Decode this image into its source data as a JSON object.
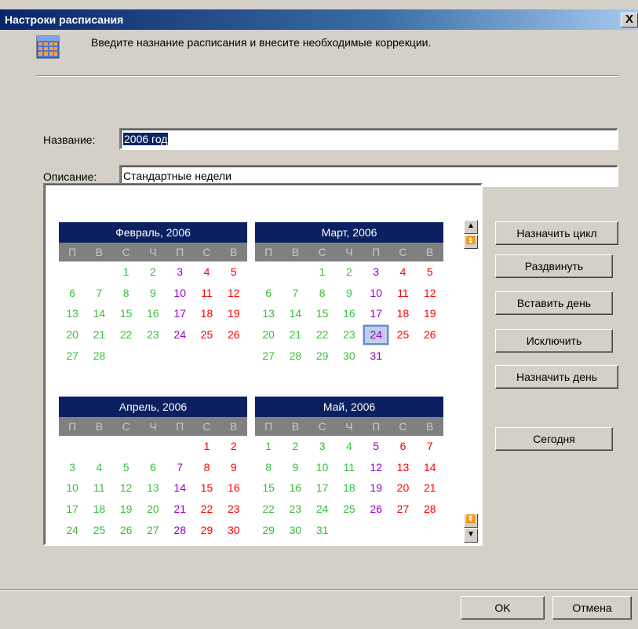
{
  "window": {
    "title": "Настроки расписания",
    "close_glyph": "X"
  },
  "header": {
    "message": "Введите назнание расписания и внесите необходимые коррекции.",
    "icon": "calendar-icon"
  },
  "form": {
    "name_label": "Название:",
    "name_value": "2006 год",
    "description_label": "Описание:",
    "description_value": "Стандартные недели"
  },
  "calendar": {
    "weekday_headers": [
      "П",
      "В",
      "С",
      "Ч",
      "П",
      "С",
      "В"
    ],
    "today": {
      "month_index": 1,
      "day": 24
    },
    "months": [
      {
        "title": "Февраль, 2006",
        "offset": 2,
        "days": 28
      },
      {
        "title": "Март, 2006",
        "offset": 2,
        "days": 31
      },
      {
        "title": "Апрель, 2006",
        "offset": 5,
        "days": 30
      },
      {
        "title": "Май, 2006",
        "offset": 0,
        "days": 31
      }
    ],
    "day_colors": {
      "weekday": "#39c03a",
      "friday": "#9900cc",
      "weekend": "#ff0000"
    }
  },
  "scroll": {
    "up": "▲",
    "page_up": "⏫",
    "page_down": "⏬",
    "down": "▼"
  },
  "actions": {
    "assign_cycle": "Назначить цикл",
    "spread": "Раздвинуть",
    "insert_day": "Вставить день",
    "exclude": "Исключить",
    "assign_day": "Назначить день",
    "today": "Сегодня"
  },
  "footer": {
    "ok": "OK",
    "cancel": "Отмена"
  }
}
